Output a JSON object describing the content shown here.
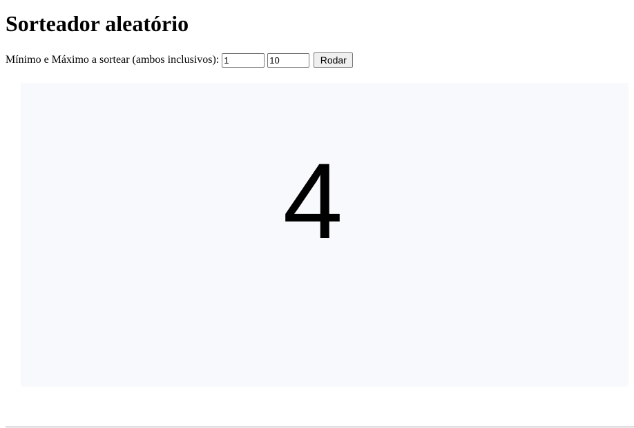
{
  "page": {
    "title": "Sorteador aleatório"
  },
  "controls": {
    "label": "Mínimo e Máximo a sortear (ambos inclusivos):",
    "min_value": "1",
    "max_value": "10",
    "spin_button_label": "Rodar"
  },
  "result": {
    "value": "4",
    "panel_color": "#f8f9fd"
  }
}
